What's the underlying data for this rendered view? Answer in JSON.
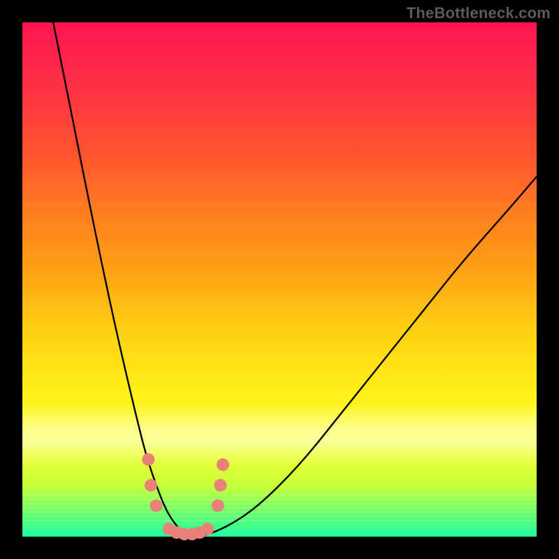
{
  "watermark": "TheBottleneck.com",
  "chart_data": {
    "type": "line",
    "title": "",
    "xlabel": "",
    "ylabel": "",
    "x_range": [
      0,
      100
    ],
    "y_range_percent_of_height": [
      0,
      100
    ],
    "gradient_bands": [
      {
        "pos": 0.0,
        "color": "#ff1550",
        "meaning": "worst"
      },
      {
        "pos": 0.5,
        "color": "#ffd012",
        "meaning": "medium"
      },
      {
        "pos": 1.0,
        "color": "#20ffa5",
        "meaning": "best"
      }
    ],
    "series": [
      {
        "name": "bottleneck-curve",
        "description": "V-shaped curve; y≈0 at match point, rises steeply left and gradually right",
        "x": [
          6,
          10,
          14,
          18,
          22,
          24,
          26,
          28,
          30,
          32,
          35,
          40,
          46,
          54,
          62,
          70,
          78,
          86,
          94,
          100
        ],
        "y_percent": [
          100,
          80,
          60,
          41,
          24,
          16,
          10,
          5,
          2,
          0,
          0,
          2,
          6,
          14,
          24,
          34,
          44,
          54,
          63,
          70
        ],
        "match_x_range": [
          30,
          36
        ]
      }
    ],
    "markers": {
      "name": "highlight-dots",
      "color": "#e98079",
      "radius_px": 9,
      "points_x_y_percent": [
        [
          24.5,
          15
        ],
        [
          25.0,
          10
        ],
        [
          26.0,
          6
        ],
        [
          28.5,
          1.5
        ],
        [
          30.0,
          0.8
        ],
        [
          31.5,
          0.5
        ],
        [
          33.0,
          0.5
        ],
        [
          34.5,
          0.8
        ],
        [
          36.0,
          1.5
        ],
        [
          38.0,
          6
        ],
        [
          38.5,
          10
        ],
        [
          39.0,
          14
        ]
      ]
    }
  }
}
